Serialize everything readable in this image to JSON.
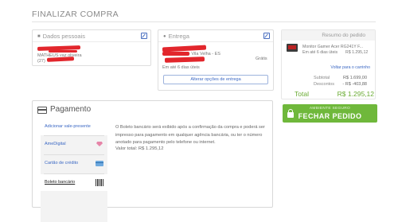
{
  "page": {
    "title": "FINALIZAR COMPRA"
  },
  "personal": {
    "heading": "Dados pessoais",
    "name": "MATHEUS vaz oliveira",
    "phone": "(27)"
  },
  "delivery": {
    "heading": "Entrega",
    "city": "- Vila Velha - ES",
    "eta": "Em até 6 dias úteis",
    "price": "Grátis",
    "change_button": "Alterar opções de entrega"
  },
  "summary": {
    "heading": "Resumo do pedido",
    "product_name": "Monitor Gamer Acer RG241Y F...",
    "product_eta": "Em até 6 dias úteis",
    "product_price": "R$ 1.295,12",
    "back_link": "Voltar para o carrinho",
    "subtotal_label": "Subtotal",
    "subtotal_value": "R$ 1.699,00",
    "discount_label": "Descontos",
    "discount_value": "- R$ -403,88",
    "total_label": "Total",
    "total_value": "R$ 1.295,12",
    "secure_label": "AMBIENTE SEGURO",
    "finalize_label": "FECHAR PEDIDO"
  },
  "payment": {
    "heading": "Pagamento",
    "voucher_link": "Adicionar vale-presente",
    "methods": [
      "AmeDigital",
      "Cartão de crédito",
      "Boleto bancário"
    ],
    "selected": "Boleto bancário",
    "description": "O Boleto bancário será exibido após a confirmação da compra e poderá ser impresso para pagamento em qualquer agência bancária, ou ter o número anotado para pagamento pelo telefone ou internet.",
    "value_line": "Valor total: R$ 1.295,12"
  },
  "colors": {
    "accent_green": "#6fb83b",
    "link_blue": "#3b68c4",
    "redaction": "#e2262c"
  }
}
